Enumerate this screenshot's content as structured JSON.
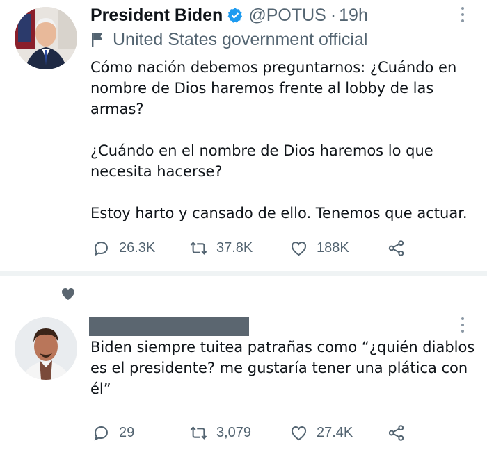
{
  "tweets": [
    {
      "display_name": "President Biden",
      "handle": "@POTUS",
      "separator": "·",
      "time": "19h",
      "label": "United States government official",
      "paragraphs": [
        "Cómo nación debemos preguntarnos: ¿Cuándo en nombre de Dios haremos frente al lobby de las armas?",
        "¿Cuándo en el nombre de Dios haremos lo que necesita hacerse?",
        "Estoy harto y cansado de ello. Tenemos que actuar."
      ],
      "replies": "26.3K",
      "retweets": "37.8K",
      "likes": "188K"
    },
    {
      "paragraphs": [
        "Biden siempre tuitea patrañas como “¿quién diablos es el presidente? me gustaría tener una plática con él”"
      ],
      "replies": "29",
      "retweets": "3,079",
      "likes": "27.4K"
    }
  ],
  "colors": {
    "verified": "#1d9bf0",
    "secondary_text": "#536471",
    "divider": "#eff3f4"
  },
  "icons": [
    "verified-badge-icon",
    "flag-icon",
    "more-icon",
    "reply-icon",
    "retweet-icon",
    "like-icon",
    "share-icon",
    "heart-icon"
  ]
}
